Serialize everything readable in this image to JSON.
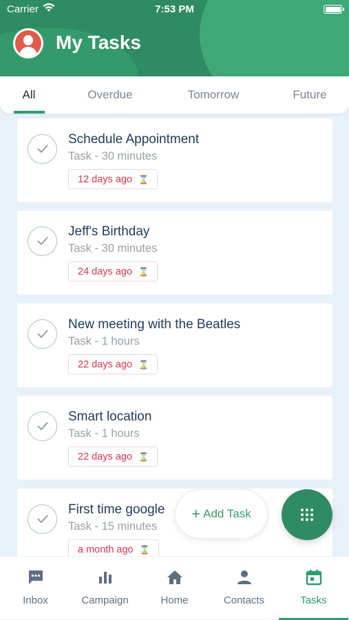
{
  "status_bar": {
    "carrier": "Carrier",
    "time": "7:53 PM"
  },
  "header": {
    "title": "My Tasks"
  },
  "tabs": [
    {
      "label": "All",
      "active": true
    },
    {
      "label": "Overdue",
      "active": false
    },
    {
      "label": "Tomorrow",
      "active": false
    },
    {
      "label": "Future",
      "active": false
    }
  ],
  "tasks": [
    {
      "title": "Schedule Appointment",
      "subtitle": "Task - 30 minutes",
      "due": "12 days ago"
    },
    {
      "title": "Jeff's Birthday",
      "subtitle": "Task - 30 minutes",
      "due": "24 days ago"
    },
    {
      "title": "New meeting with the Beatles",
      "subtitle": "Task - 1 hours",
      "due": "22 days ago"
    },
    {
      "title": "Smart location",
      "subtitle": "Task - 1 hours",
      "due": "22 days ago"
    },
    {
      "title": "First time google",
      "subtitle": "Task - 15 minutes",
      "due": "a month ago"
    }
  ],
  "actions": {
    "add_task_label": "Add Task"
  },
  "bottom_nav": [
    {
      "label": "Inbox",
      "icon": "chat-icon",
      "active": false
    },
    {
      "label": "Campaign",
      "icon": "bar-chart-icon",
      "active": false
    },
    {
      "label": "Home",
      "icon": "home-icon",
      "active": false
    },
    {
      "label": "Contacts",
      "icon": "person-icon",
      "active": false
    },
    {
      "label": "Tasks",
      "icon": "calendar-icon",
      "active": true
    }
  ],
  "colors": {
    "brand_green": "#2e8b63",
    "accent_green": "#2e9d6e",
    "overdue_red": "#e2324f",
    "title_navy": "#1f3a5c"
  }
}
